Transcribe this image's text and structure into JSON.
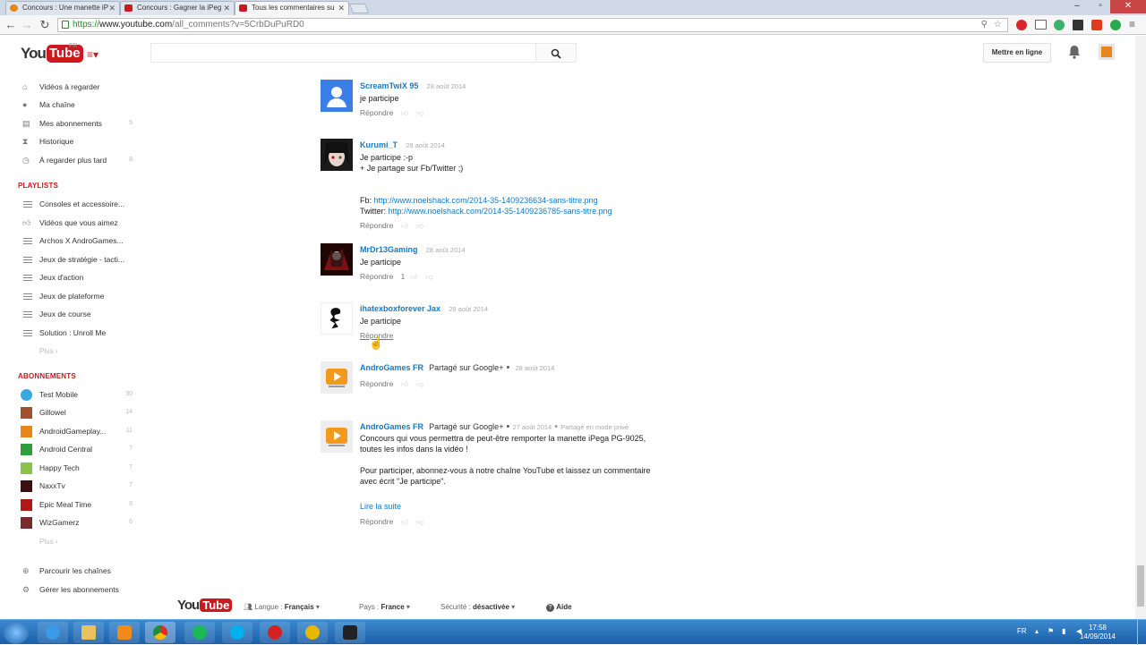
{
  "browser": {
    "tabs": [
      {
        "title": "Concours : Une manette iP",
        "icon": "orange-play-icon"
      },
      {
        "title": "Concours : Gagner la iPeg",
        "icon": "youtube-icon"
      },
      {
        "title": "Tous les commentaires su",
        "icon": "youtube-icon"
      }
    ],
    "url_prefix": "https://",
    "url_host": "www.youtube.com",
    "url_path": "/all_comments?v=5CrbDuPuRD0",
    "window_controls": [
      "–",
      "▫",
      "✕"
    ]
  },
  "header": {
    "logo_you": "You",
    "logo_tube": "Tube",
    "logo_region": "FR",
    "upload_label": "Mettre en ligne"
  },
  "guide": {
    "main": [
      {
        "label": "Vidéos à regarder",
        "icon": "home-icon",
        "count": ""
      },
      {
        "label": "Ma chaîne",
        "icon": "user-icon",
        "count": ""
      },
      {
        "label": "Mes abonnements",
        "icon": "subscriptions-icon",
        "count": "5"
      },
      {
        "label": "Historique",
        "icon": "hourglass-icon",
        "count": ""
      },
      {
        "label": "À regarder plus tard",
        "icon": "clock-icon",
        "count": "8"
      }
    ],
    "playlists_title": "PLAYLISTS",
    "playlists": [
      {
        "label": "Consoles et accessoire..."
      },
      {
        "label": "Vidéos que vous aimez"
      },
      {
        "label": "Archos X AndroGames..."
      },
      {
        "label": "Jeux de stratégie - tacti..."
      },
      {
        "label": "Jeux d'action"
      },
      {
        "label": "Jeux de plateforme"
      },
      {
        "label": "Jeux de course"
      },
      {
        "label": "Solution : Unroll Me"
      }
    ],
    "more_label": "Plus ›",
    "subs_title": "ABONNEMENTS",
    "subs": [
      {
        "label": "Test Mobile",
        "count": "30",
        "color": "#3aa8e0"
      },
      {
        "label": "Gillowel",
        "count": "14",
        "color": "#a0522d"
      },
      {
        "label": "AndroidGameplay...",
        "count": "11",
        "color": "#e8861c"
      },
      {
        "label": "Android Central",
        "count": "7",
        "color": "#2e9e3e"
      },
      {
        "label": "Happy Tech",
        "count": "7",
        "color": "#8bc34a"
      },
      {
        "label": "NaxxTv",
        "count": "7",
        "color": "#3a1010"
      },
      {
        "label": "Epic Meal Time",
        "count": "6",
        "color": "#b01818"
      },
      {
        "label": "WizGamerz",
        "count": "6",
        "color": "#7a2a2a"
      }
    ],
    "subs_more_label": "Plus ›",
    "browse_channels": "Parcourir les chaînes",
    "manage_subs": "Gérer les abonnements"
  },
  "comments": [
    {
      "author": "ScreamTwiX 95",
      "date": "28 août 2014",
      "lines": [
        "je participe"
      ],
      "reply": "Répondre",
      "likes": ""
    },
    {
      "author": "Kurumi_T",
      "date": "28 août 2014",
      "lines": [
        "Je participe  :-p",
        "+ Je partage sur Fb/Twitter  ;)"
      ],
      "links": [
        {
          "prefix": "Fb: ",
          "url": "http://www.noelshack.com/2014-35-1409236634-sans-titre.png"
        },
        {
          "prefix": "Twitter: ",
          "url": "http://www.noelshack.com/2014-35-1409236785-sans-titre.png"
        }
      ],
      "reply": "Répondre",
      "likes": ""
    },
    {
      "author": "MrDr13Gaming",
      "date": "28 août 2014",
      "lines": [
        "Je participe"
      ],
      "reply": "Répondre",
      "likes": "1"
    },
    {
      "author": "ihatexboxforever Jax",
      "date": "28 août 2014",
      "lines": [
        "Je participe"
      ],
      "reply": "Répondre",
      "likes": ""
    },
    {
      "author": "AndroGames FR",
      "shared": "Partagé sur Google+",
      "date": "28 août 2014",
      "lines": [],
      "reply": "Répondre",
      "likes": ""
    },
    {
      "author": "AndroGames FR",
      "shared": "Partagé sur Google+",
      "date": "27 août 2014",
      "privacy": "Partagé en mode privé",
      "lines": [
        "Concours qui vous permettra de peut-être remporter la manette iPega PG-9025,",
        "toutes les infos dans la vidéo !",
        "",
        "Pour participer, abonnez-vous à notre chaîne YouTube et laissez un commentaire",
        "avec écrit \"Je participe\"."
      ],
      "read_more": "Lire la suite",
      "reply": "Répondre",
      "likes": ""
    }
  ],
  "footer": {
    "language_label": "Langue :",
    "language_value": "Français",
    "country_label": "Pays :",
    "country_value": "France",
    "safety_label": "Sécurité :",
    "safety_value": "désactivée",
    "help_label": "Aide"
  },
  "taskbar": {
    "lang": "FR",
    "time": "17:58",
    "date": "14/09/2014"
  }
}
